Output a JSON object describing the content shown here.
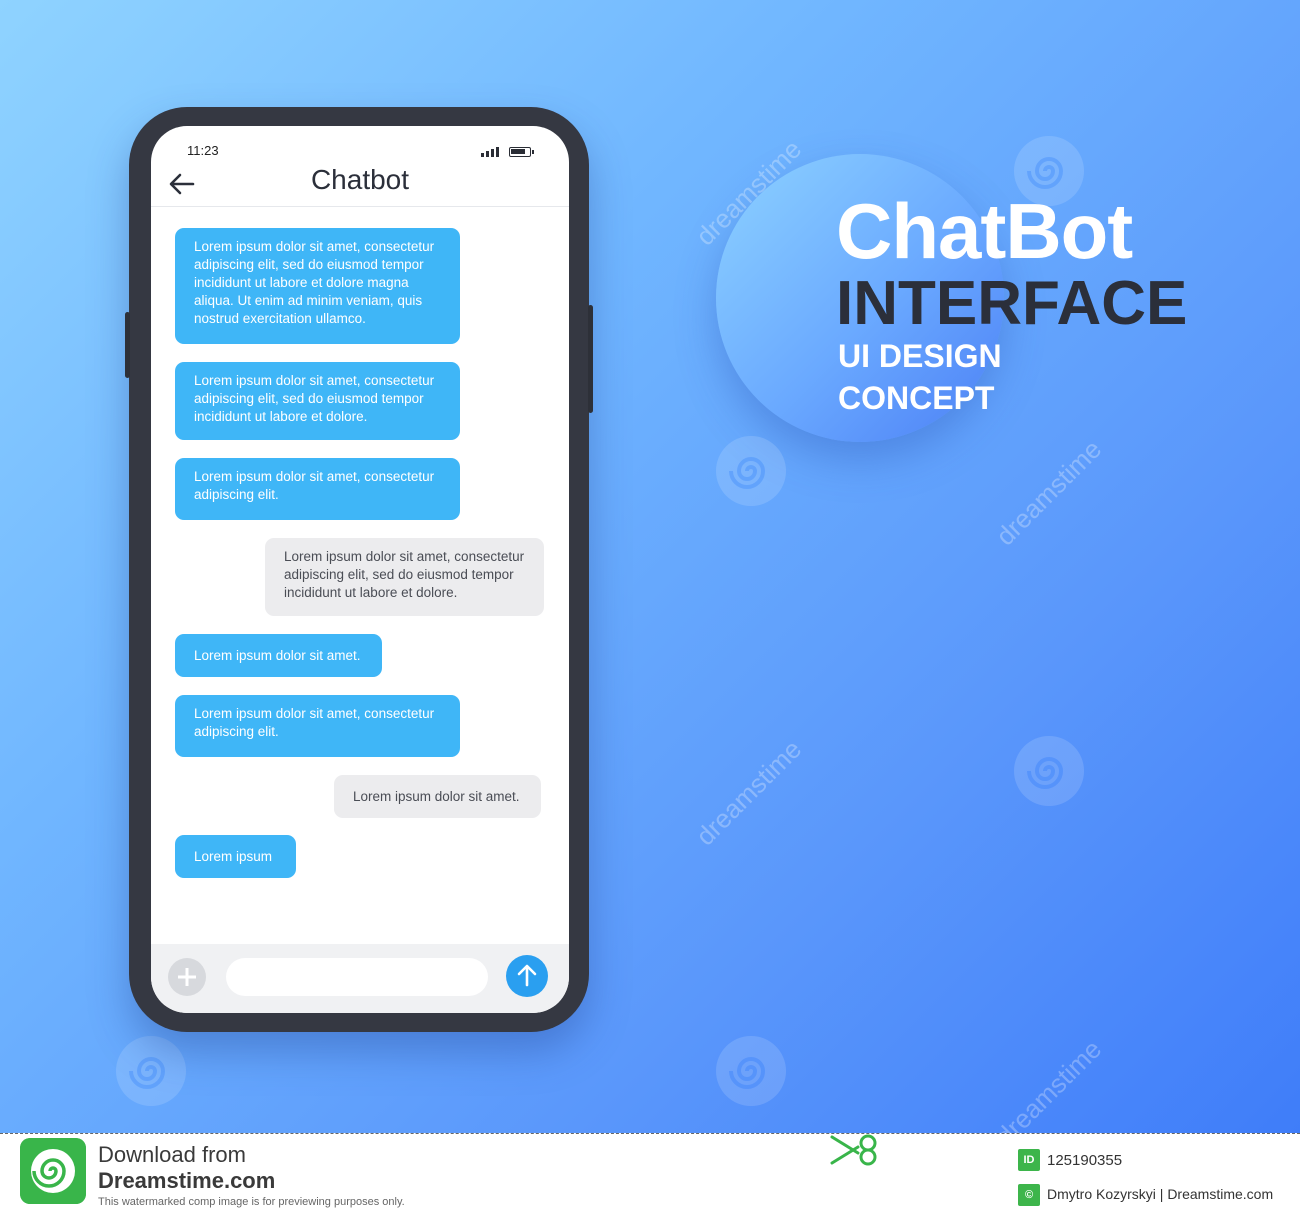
{
  "promo": {
    "title_line1": "ChatBot",
    "title_line2": "INTERFACE",
    "subtitle_line1": "UI DESIGN",
    "subtitle_line2": "CONCEPT"
  },
  "phone": {
    "status_time": "11:23",
    "header_title": "Chatbot",
    "messages": [
      {
        "sender": "bot",
        "text": "Lorem ipsum dolor sit amet, consectetur adipiscing elit, sed do eiusmod tempor incididunt ut labore et dolore magna aliqua. Ut enim ad minim veniam, quis nostrud exercitation ullamco."
      },
      {
        "sender": "bot",
        "text": "Lorem ipsum dolor sit amet, consectetur adipiscing elit, sed do eiusmod tempor incididunt ut labore et dolore."
      },
      {
        "sender": "bot",
        "text": "Lorem ipsum dolor sit amet, consectetur adipiscing elit."
      },
      {
        "sender": "user",
        "text": "Lorem ipsum dolor sit amet, consectetur adipiscing elit, sed do eiusmod tempor incididunt ut labore et dolore."
      },
      {
        "sender": "bot",
        "text": "Lorem ipsum dolor sit amet."
      },
      {
        "sender": "bot",
        "text": "Lorem ipsum dolor sit amet, consectetur adipiscing elit."
      },
      {
        "sender": "user",
        "text": "Lorem ipsum dolor sit amet."
      },
      {
        "sender": "bot",
        "text": "Lorem ipsum"
      }
    ],
    "composer": {
      "input_value": "",
      "input_placeholder": ""
    }
  },
  "footer": {
    "download_line1": "Download from",
    "download_line2": "Dreamstime.com",
    "notice": "This watermarked comp image is for previewing purposes only.",
    "id_badge": "ID",
    "image_id": "125190355",
    "credit_badge": "©",
    "credit": "Dmytro Kozyrskyi | Dreamstime.com"
  },
  "watermark": {
    "text": "dreamstime"
  },
  "colors": {
    "bot_bubble": "#3fb6f7",
    "user_bubble": "#ececee",
    "send_button": "#2a9ff0",
    "phone_frame": "#353842",
    "footer_badge": "#3db54b"
  },
  "icons": {
    "back": "arrow-left",
    "add": "plus-circle",
    "send": "arrow-up-circle"
  }
}
